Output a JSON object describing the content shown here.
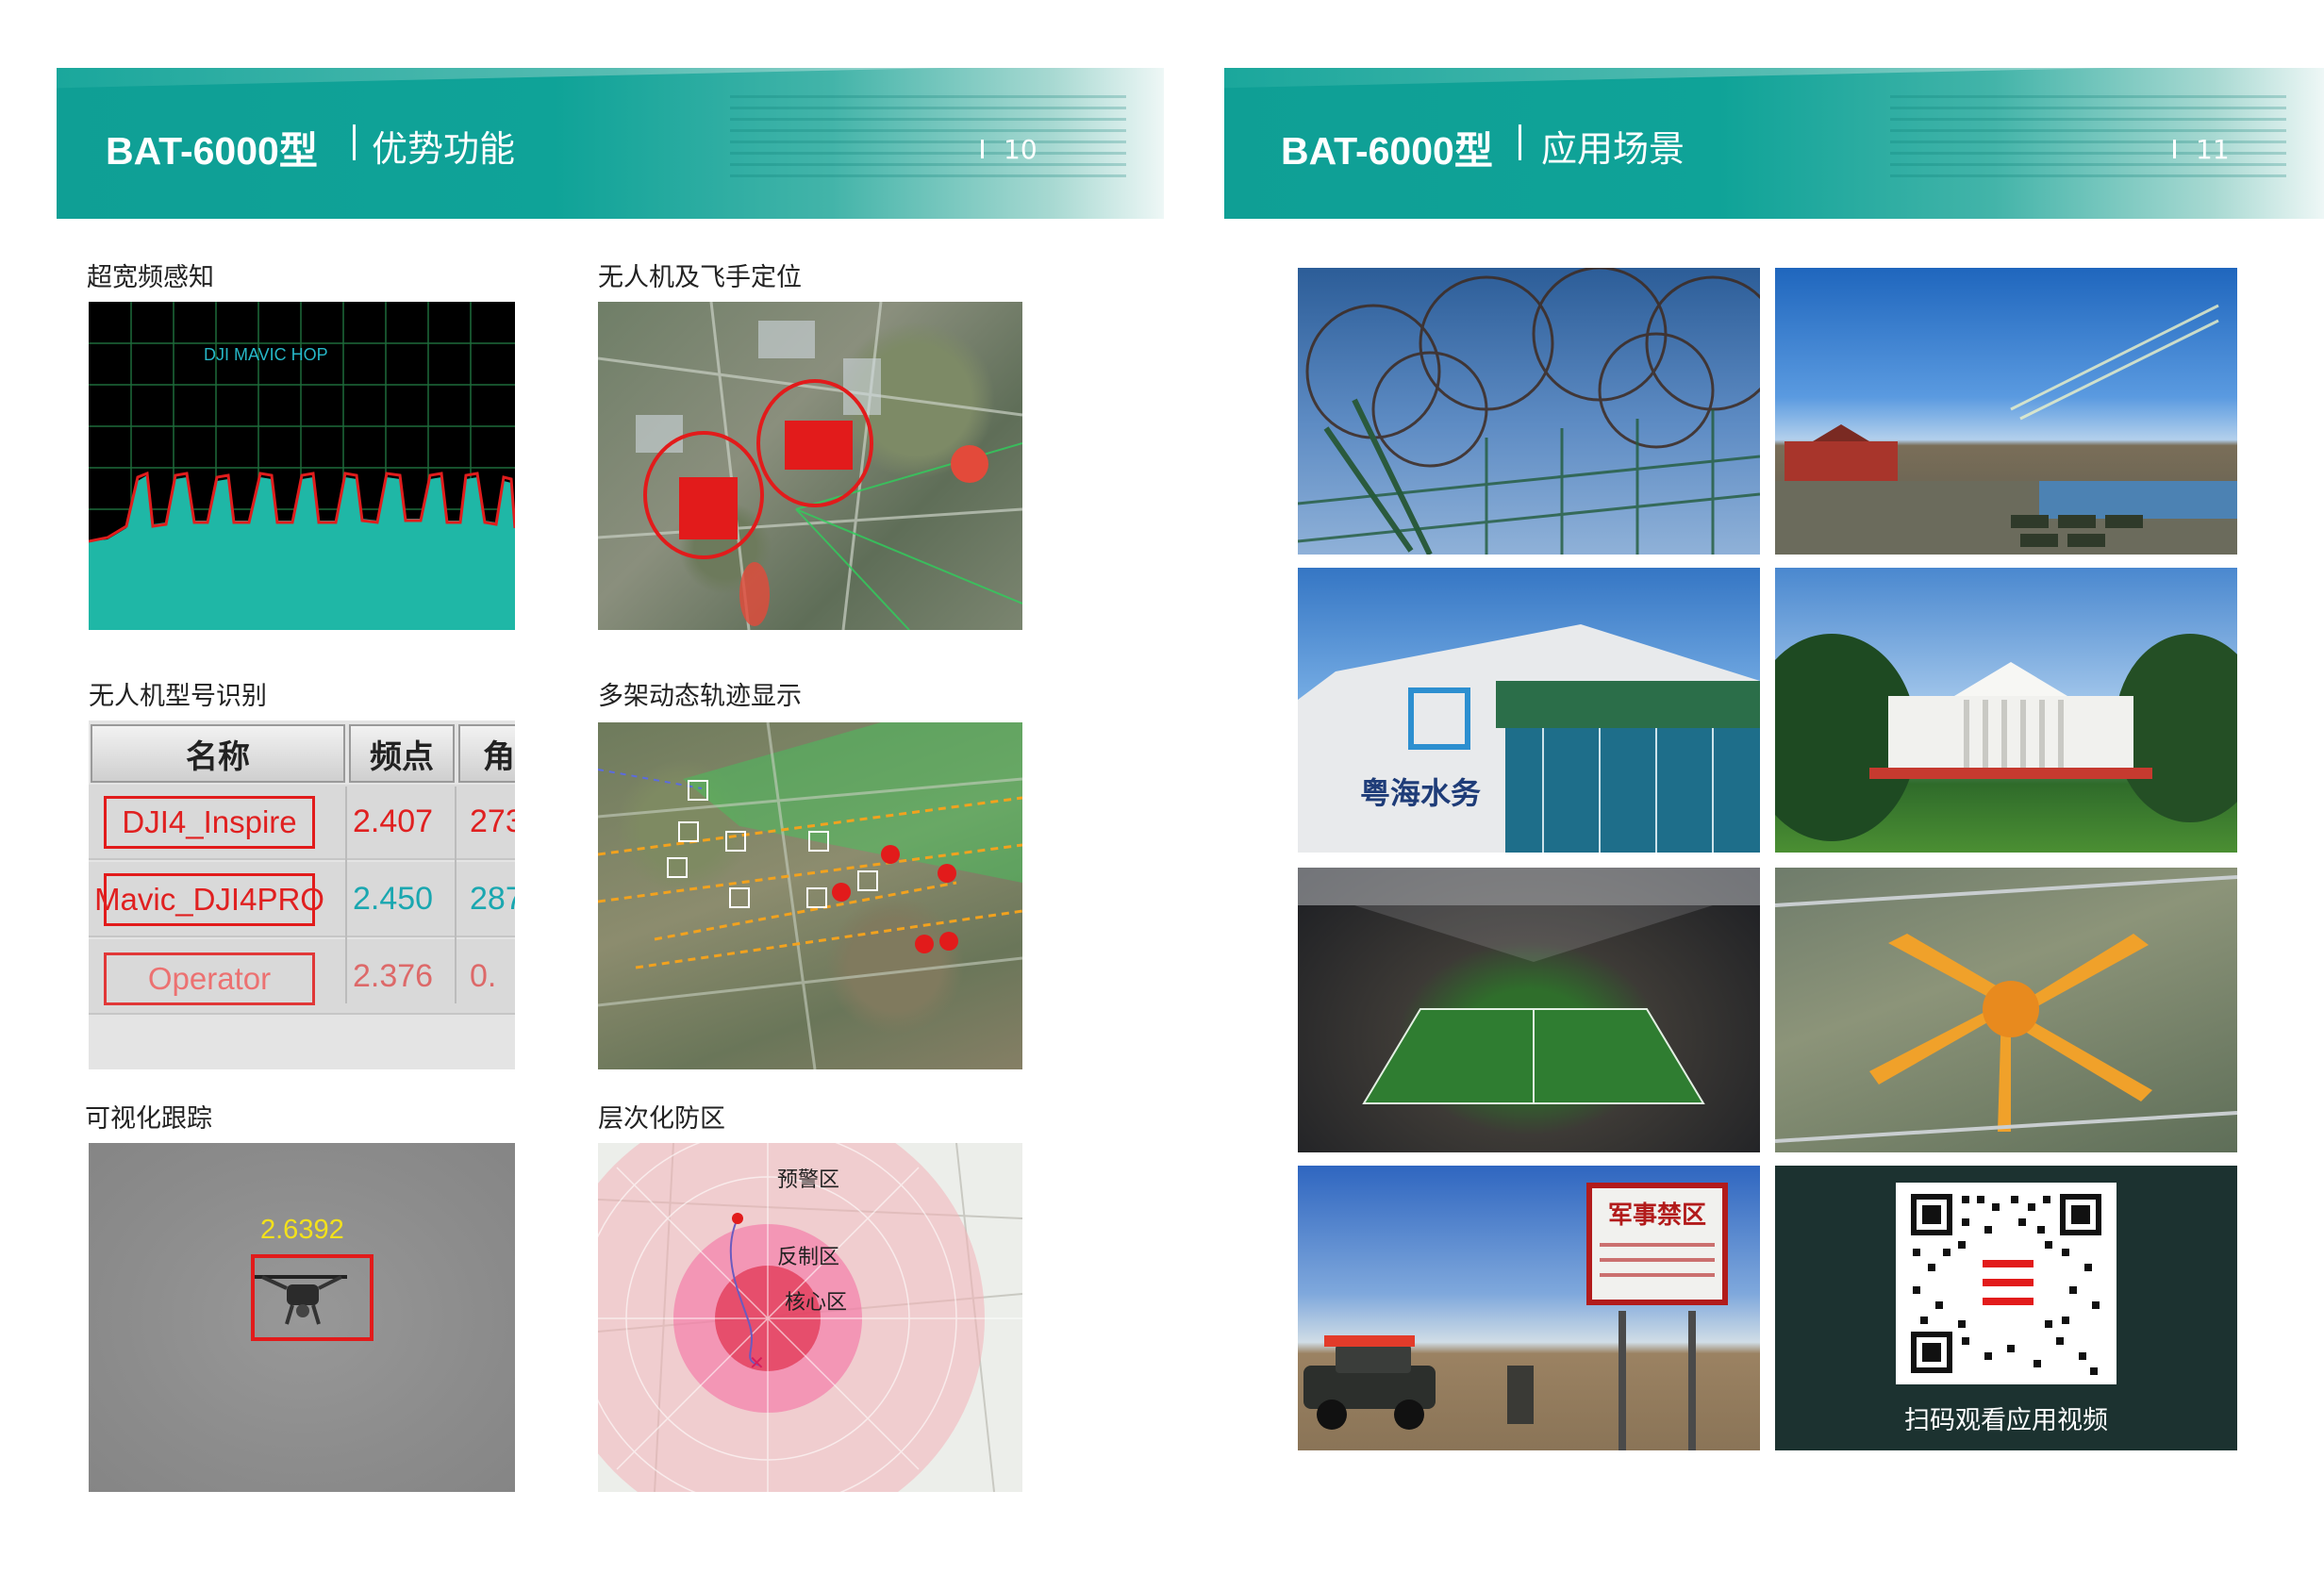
{
  "left_page": {
    "model": "BAT-6000型",
    "title": "优势功能",
    "page_number": "10",
    "sections": {
      "spectrum": {
        "label": "超宽频感知",
        "signal_label": "DJI MAVIC HOP"
      },
      "locate": {
        "label": "无人机及飞手定位"
      },
      "identify": {
        "label": "无人机型号识别",
        "columns": [
          "名称",
          "频点",
          "角"
        ],
        "rows": [
          {
            "name": "DJI4_Inspire",
            "freq": "2.407",
            "angle": "273"
          },
          {
            "name": "Mavic_DJI4PRO",
            "freq": "2.450",
            "angle": "287"
          },
          {
            "name": "Operator",
            "freq": "2.376",
            "angle": "0."
          }
        ]
      },
      "tracks": {
        "label": "多架动态轨迹显示"
      },
      "tracking": {
        "label": "可视化跟踪",
        "readout": "2.6392"
      },
      "zones": {
        "label": "层次化防区",
        "zone_labels": [
          "预警区",
          "反制区",
          "核心区"
        ]
      }
    }
  },
  "right_page": {
    "model": "BAT-6000型",
    "title": "应用场景",
    "page_number": "11",
    "photos": [
      "prison-fence",
      "military-parade",
      "water-utility",
      "white-house",
      "stadium",
      "airport",
      "restricted-zone",
      "qr-code"
    ],
    "water_sign": "粤海水务",
    "restricted_sign": "军事禁区",
    "qr_caption": "扫码观看应用视频"
  },
  "colors": {
    "header_teal": "#0f9f95",
    "alert_red": "#e21b1b",
    "spectrum_fill": "#1fb7a6",
    "spectrum_line": "#e01d1d"
  }
}
